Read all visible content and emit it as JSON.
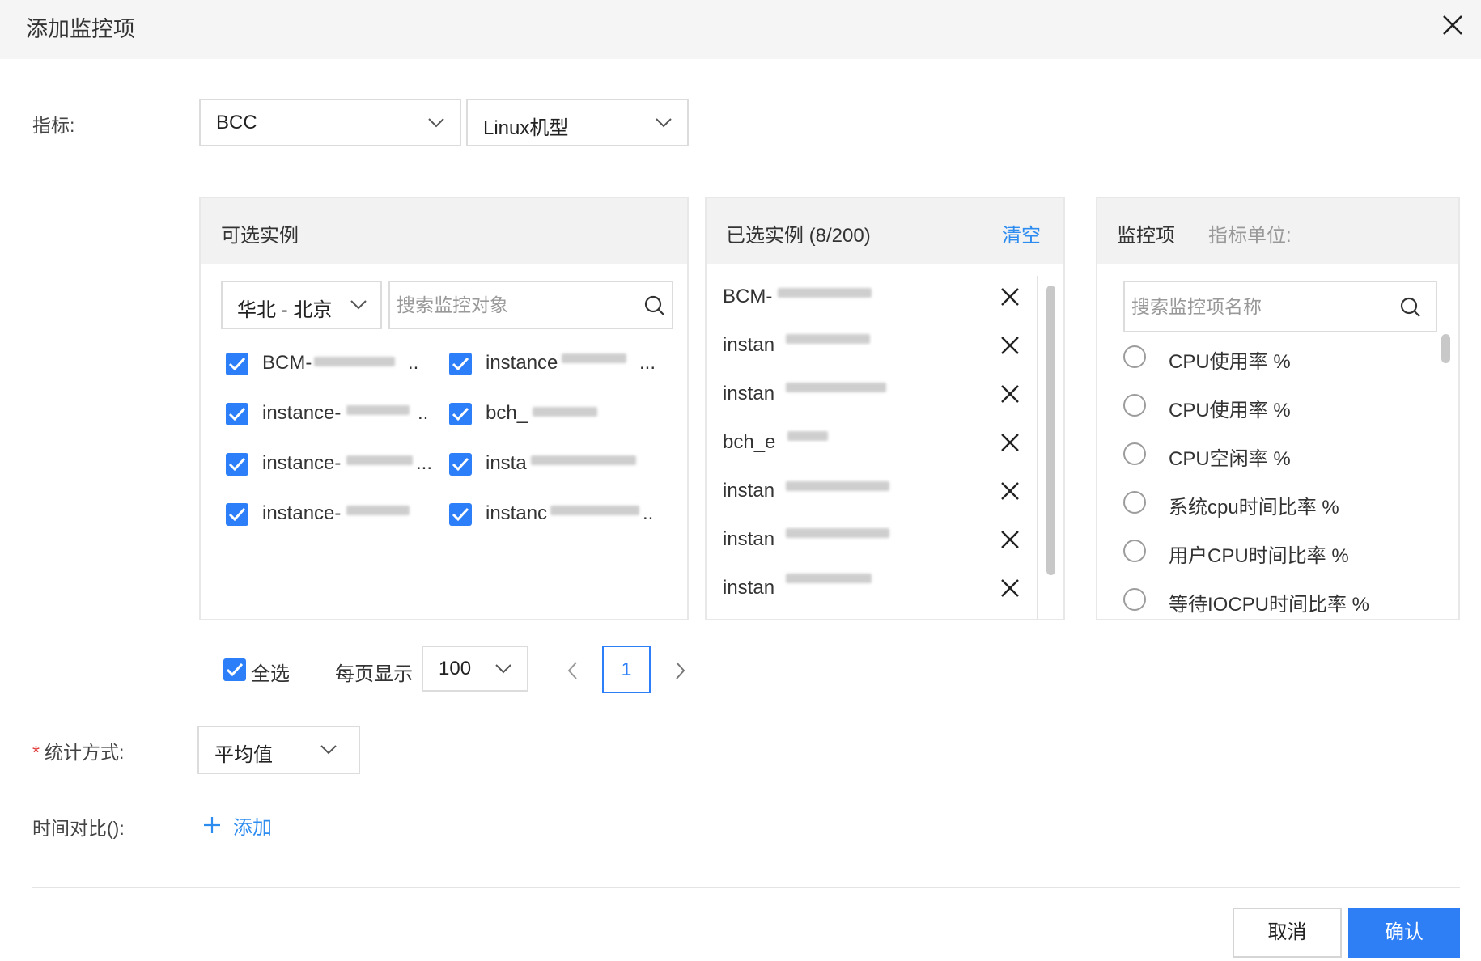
{
  "dialog": {
    "title": "添加监控项",
    "close_icon": "close-icon"
  },
  "metric": {
    "label": "指标:",
    "product_select": "BCC",
    "type_select": "Linux机型"
  },
  "available": {
    "title": "可选实例",
    "region_select": "华北 - 北京",
    "search_placeholder": "搜索监控对象",
    "items": [
      {
        "label": "BCM-",
        "suffix": "..",
        "checked": true
      },
      {
        "label": "instance",
        "suffix": "...",
        "checked": true
      },
      {
        "label": "instance-",
        "suffix": "..",
        "checked": true
      },
      {
        "label": "bch_",
        "suffix": "",
        "checked": true
      },
      {
        "label": "instance-",
        "suffix": "...",
        "checked": true
      },
      {
        "label": "insta",
        "suffix": "",
        "checked": true
      },
      {
        "label": "instance-",
        "suffix": "",
        "checked": true
      },
      {
        "label": "instanc",
        "suffix": "..",
        "checked": true
      }
    ]
  },
  "selected": {
    "title": "已选实例 (8/200)",
    "clear_label": "清空",
    "items": [
      "BCM-",
      "instan",
      "instan",
      "bch_e",
      "instan",
      "instan",
      "instan"
    ]
  },
  "monitor": {
    "title": "监控项",
    "unit_label": "指标单位:",
    "search_placeholder": "搜索监控项名称",
    "items": [
      "CPU使用率 %",
      "CPU使用率 %",
      "CPU空闲率 %",
      "系统cpu时间比率 %",
      "用户CPU时间比率 %",
      "等待IOCPU时间比率 %"
    ]
  },
  "pagination": {
    "select_all_label": "全选",
    "per_page_label": "每页显示",
    "per_page_value": "100",
    "current_page": "1"
  },
  "stat": {
    "label": "统计方式:",
    "required_mark": "*",
    "value": "平均值"
  },
  "compare": {
    "label": "时间对比():",
    "add_label": "添加"
  },
  "footer": {
    "cancel_label": "取消",
    "confirm_label": "确认"
  },
  "colors": {
    "accent": "#2d7ff9",
    "link": "#2d8cf0",
    "header_bg": "#f5f5f5",
    "panel_head_bg": "#f2f2f2"
  }
}
